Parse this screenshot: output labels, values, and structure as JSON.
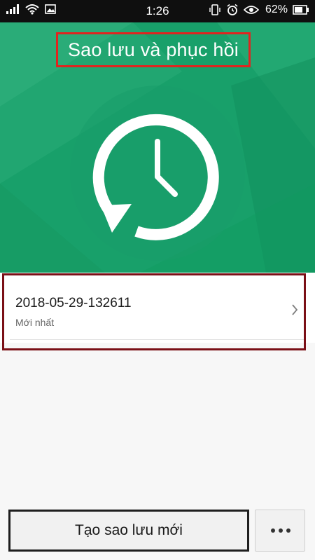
{
  "status_bar": {
    "time": "1:26",
    "battery_percent": "62%",
    "icons": [
      "signal-icon",
      "wifi-icon",
      "image-notification-icon",
      "vibrate-icon",
      "alarm-icon",
      "eye-icon",
      "battery-icon"
    ]
  },
  "header": {
    "title": "Sao lưu và phục hồi"
  },
  "colors": {
    "hero_green": "#18a06a",
    "title_highlight": "#e0241f",
    "item_highlight": "#7a0f16"
  },
  "backups": [
    {
      "name": "2018-05-29-132611",
      "label": "Mới nhất"
    }
  ],
  "actions": {
    "create_label": "Tạo sao lưu mới",
    "more_icon": "more-dots-icon"
  }
}
